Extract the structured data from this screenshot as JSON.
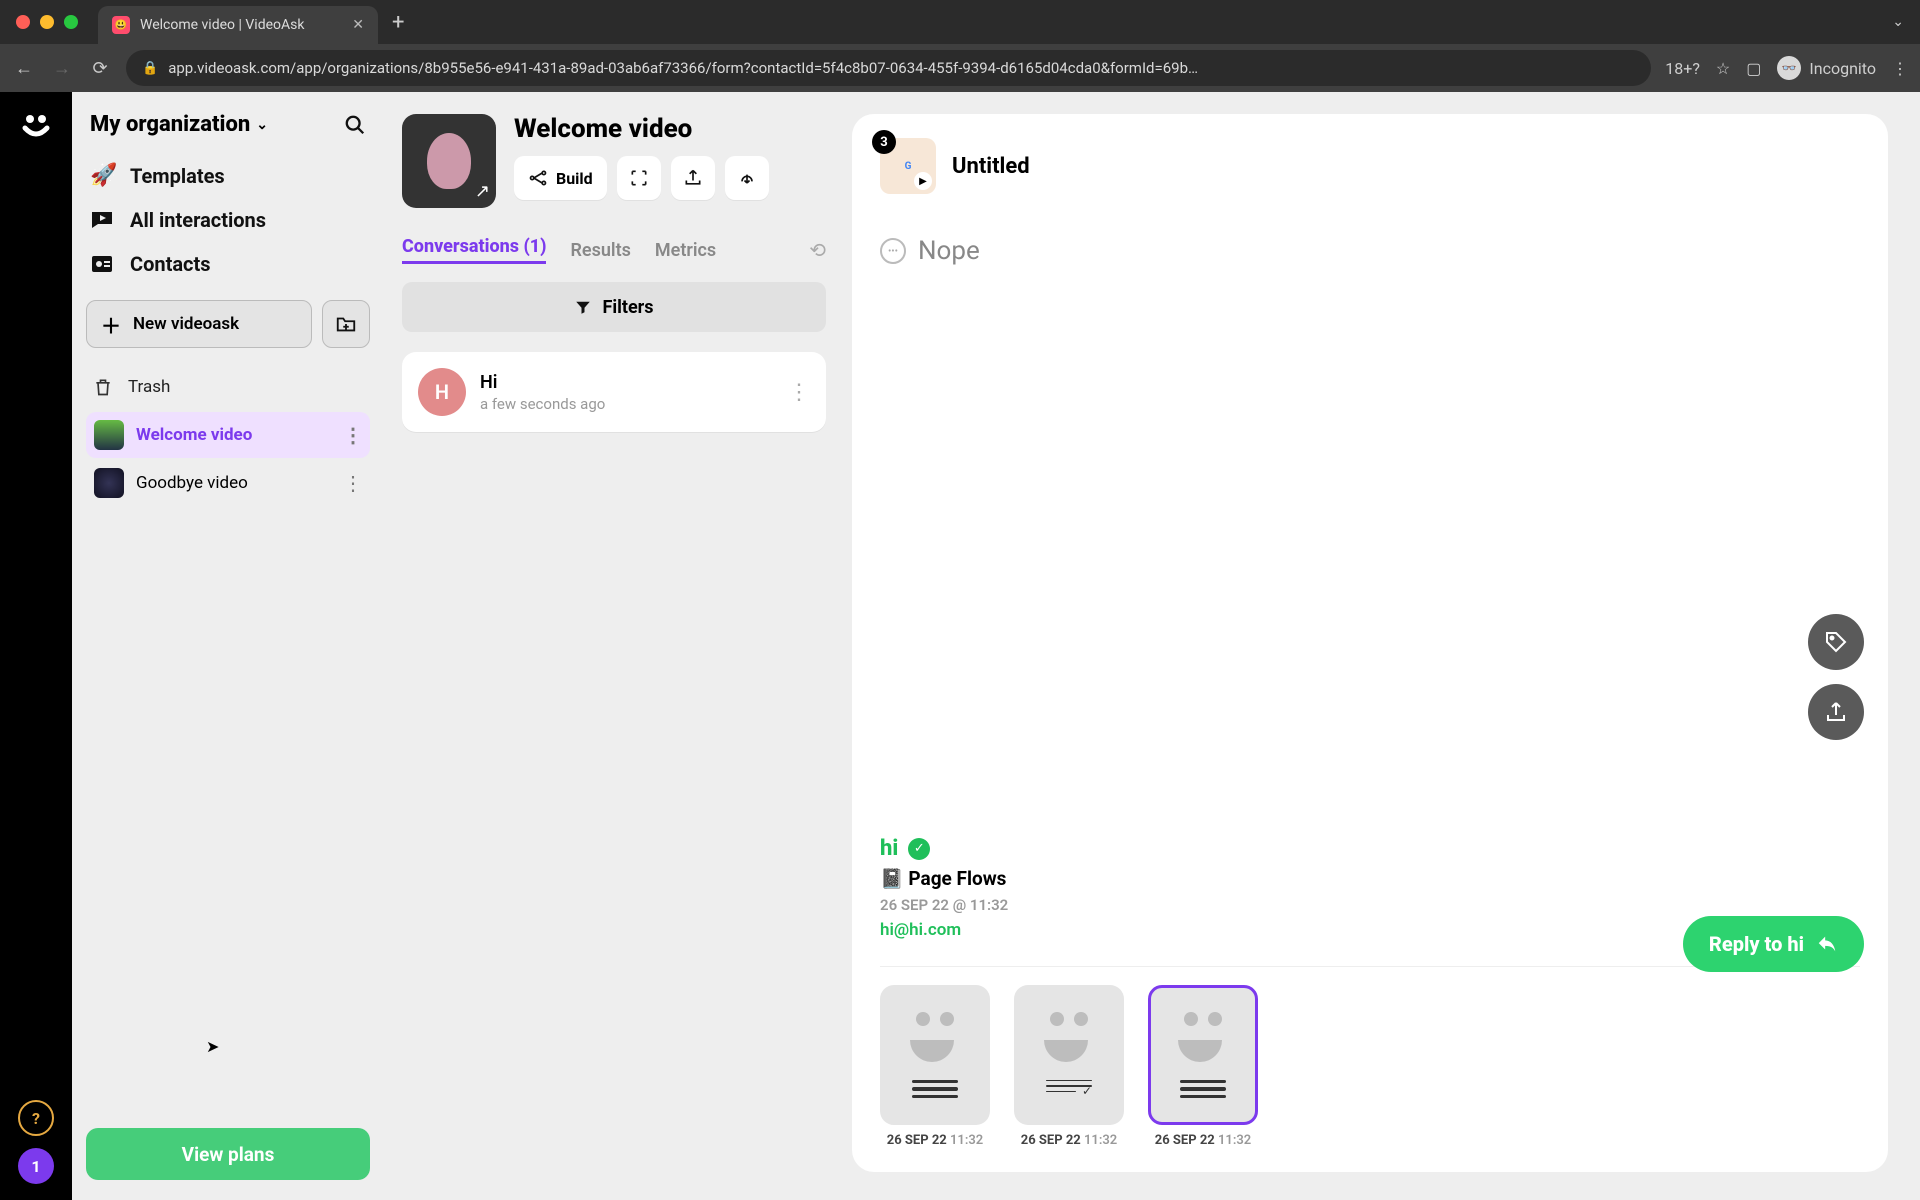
{
  "browser": {
    "tab_title": "Welcome video | VideoAsk",
    "url": "app.videoask.com/app/organizations/8b955e56-e941-431a-89ad-03ab6af73366/form?contactId=5f4c8b07-0634-455f-9394-d6165d04cda0&formId=69b…",
    "incognito_label": "Incognito"
  },
  "rail": {
    "help": "?",
    "notif_count": "1"
  },
  "sidebar": {
    "org_label": "My organization",
    "nav": {
      "templates": "Templates",
      "interactions": "All interactions",
      "contacts": "Contacts"
    },
    "new_button": "New videoask",
    "trash": "Trash",
    "videos": [
      {
        "label": "Welcome video",
        "active": true
      },
      {
        "label": "Goodbye video",
        "active": false
      }
    ],
    "plans": "View plans"
  },
  "main": {
    "title": "Welcome video",
    "build": "Build",
    "tabs": {
      "conversations": "Conversations (1)",
      "results": "Results",
      "metrics": "Metrics"
    },
    "filters": "Filters",
    "conversation": {
      "initial": "H",
      "name": "Hi",
      "time": "a few seconds ago"
    }
  },
  "detail": {
    "badge": "3",
    "untitled": "Untitled",
    "answer": "Nope",
    "contact": {
      "name": "hi",
      "org": "📓 Page Flows",
      "date": "26 SEP 22 @ 11:32",
      "email": "hi@hi.com"
    },
    "reply": "Reply to hi",
    "responses": [
      {
        "date": "26 SEP 22",
        "time": "11:32"
      },
      {
        "date": "26 SEP 22",
        "time": "11:32"
      },
      {
        "date": "26 SEP 22",
        "time": "11:32"
      }
    ]
  }
}
